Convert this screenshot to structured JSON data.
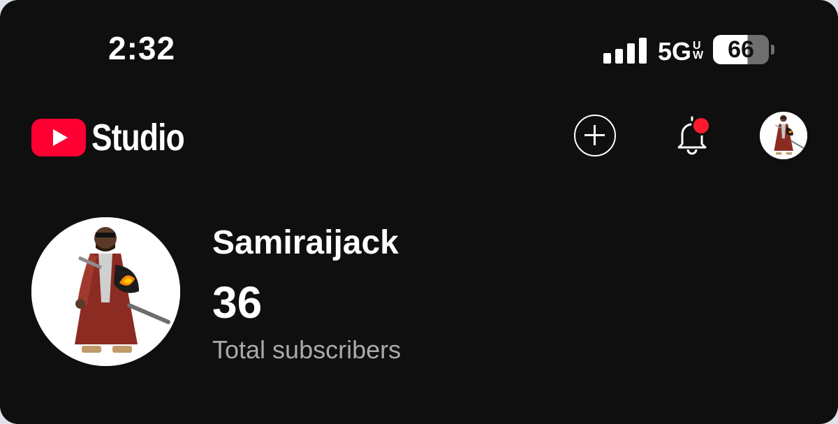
{
  "status_bar": {
    "time": "2:32",
    "network": "5G",
    "network_suffix": "UW",
    "battery_level": "66",
    "battery_fraction": 0.66,
    "signal_bars": 4
  },
  "header": {
    "logo_text": "Studio",
    "actions": [
      {
        "name": "create",
        "icon": "plus-circle-icon"
      },
      {
        "name": "notifications",
        "icon": "bell-icon",
        "has_unread": true
      },
      {
        "name": "account",
        "icon": "avatar"
      }
    ]
  },
  "channel": {
    "name": "Samiraijack",
    "subscriber_count": "36",
    "subscriber_label": "Total subscribers"
  },
  "colors": {
    "background": "#0f0f0f",
    "brand_red": "#ff0033",
    "notification_dot": "#ff1a2e",
    "secondary_text": "#aaaaaa"
  }
}
